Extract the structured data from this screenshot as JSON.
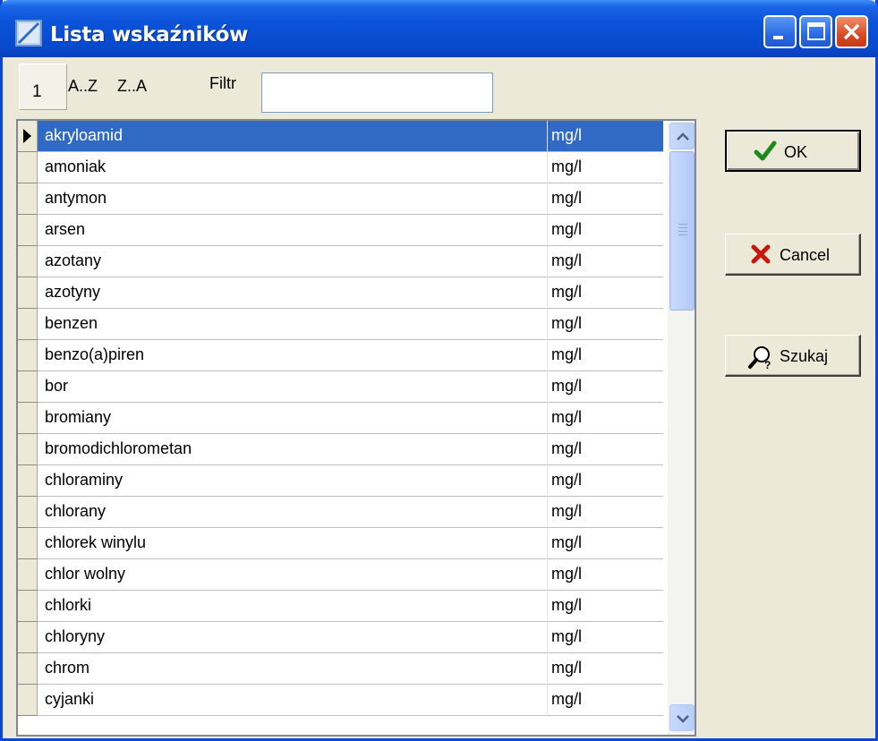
{
  "window": {
    "title": "Lista wskaźników",
    "accent": "#0a53d8",
    "controls": [
      "minimize-icon",
      "maximize-icon",
      "close-icon"
    ]
  },
  "toolbar": {
    "sort_numeric": "1",
    "sort_az": "A..Z",
    "sort_za": "Z..A",
    "filter_label": "Filtr",
    "filter_value": ""
  },
  "grid": {
    "selected_index": 0,
    "selection_color": "#316ac5",
    "rows": [
      {
        "name": "akryloamid",
        "unit": "mg/l"
      },
      {
        "name": "amoniak",
        "unit": "mg/l"
      },
      {
        "name": "antymon",
        "unit": "mg/l"
      },
      {
        "name": "arsen",
        "unit": "mg/l"
      },
      {
        "name": "azotany",
        "unit": "mg/l"
      },
      {
        "name": "azotyny",
        "unit": "mg/l"
      },
      {
        "name": "benzen",
        "unit": "mg/l"
      },
      {
        "name": "benzo(a)piren",
        "unit": "mg/l"
      },
      {
        "name": "bor",
        "unit": "mg/l"
      },
      {
        "name": "bromiany",
        "unit": "mg/l"
      },
      {
        "name": "bromodichlorometan",
        "unit": "mg/l"
      },
      {
        "name": "chloraminy",
        "unit": "mg/l"
      },
      {
        "name": "chlorany",
        "unit": "mg/l"
      },
      {
        "name": "chlorek winylu",
        "unit": "mg/l"
      },
      {
        "name": "chlor wolny",
        "unit": "mg/l"
      },
      {
        "name": "chlorki",
        "unit": "mg/l"
      },
      {
        "name": "chloryny",
        "unit": "mg/l"
      },
      {
        "name": "chrom",
        "unit": "mg/l"
      },
      {
        "name": "cyjanki",
        "unit": "mg/l"
      }
    ]
  },
  "buttons": {
    "ok_label": "OK",
    "ok_icon": "checkmark-icon",
    "cancel_label": "Cancel",
    "cancel_icon": "x-mark-icon",
    "search_label": "Szukaj",
    "search_icon": "magnifier-question-icon"
  }
}
